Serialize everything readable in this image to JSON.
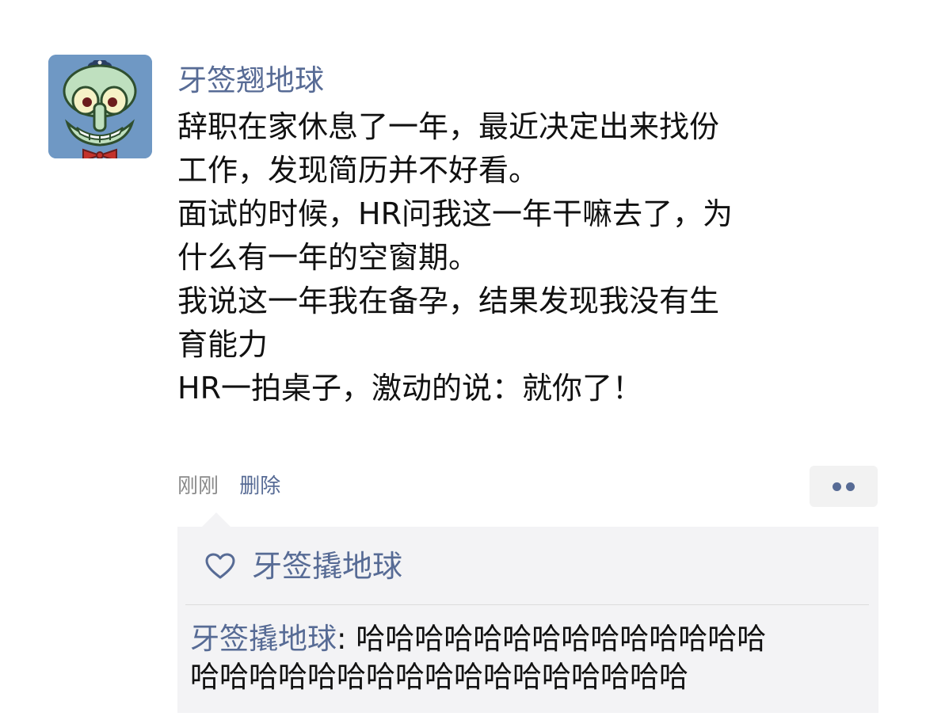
{
  "post": {
    "author": "牙签翘地球",
    "avatar_icon": "squidward-avatar-icon",
    "avatar_bg_color": "#6f98c4",
    "body_lines": [
      "辞职在家休息了一年，最近决定出来找份",
      "工作，发现简历并不好看。",
      "面试的时候，HR问我这一年干嘛去了，为",
      "什么有一年的空窗期。",
      "我说这一年我在备孕，结果发现我没有生",
      "育能力",
      "HR一拍桌子，激动的说：就你了！"
    ],
    "time": "刚刚",
    "delete_label": "删除",
    "more_icon": "more-dots-icon"
  },
  "interactions": {
    "like_icon": "heart-icon",
    "likers": "牙签撬地球",
    "comments": [
      {
        "author": "牙签撬地球",
        "separator": ": ",
        "text_line1": "哈哈哈哈哈哈哈哈哈哈哈哈哈哈",
        "text_line2": "哈哈哈哈哈哈哈哈哈哈哈哈哈哈哈哈哈"
      }
    ]
  },
  "colors": {
    "link": "#576b95",
    "text": "#111111",
    "meta": "#8a8a8a",
    "comment_bg": "#f3f3f5"
  }
}
